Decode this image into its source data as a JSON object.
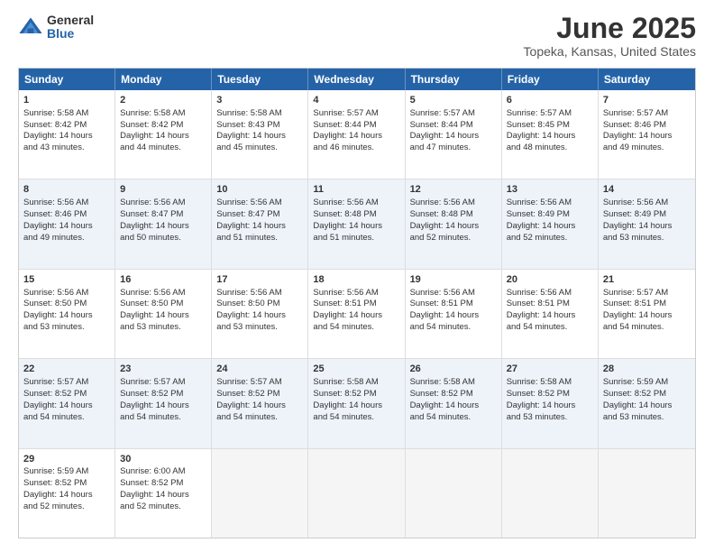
{
  "logo": {
    "general": "General",
    "blue": "Blue"
  },
  "title": "June 2025",
  "location": "Topeka, Kansas, United States",
  "headers": [
    "Sunday",
    "Monday",
    "Tuesday",
    "Wednesday",
    "Thursday",
    "Friday",
    "Saturday"
  ],
  "rows": [
    [
      {
        "day": "1",
        "lines": [
          "Sunrise: 5:58 AM",
          "Sunset: 8:42 PM",
          "Daylight: 14 hours",
          "and 43 minutes."
        ]
      },
      {
        "day": "2",
        "lines": [
          "Sunrise: 5:58 AM",
          "Sunset: 8:42 PM",
          "Daylight: 14 hours",
          "and 44 minutes."
        ]
      },
      {
        "day": "3",
        "lines": [
          "Sunrise: 5:58 AM",
          "Sunset: 8:43 PM",
          "Daylight: 14 hours",
          "and 45 minutes."
        ]
      },
      {
        "day": "4",
        "lines": [
          "Sunrise: 5:57 AM",
          "Sunset: 8:44 PM",
          "Daylight: 14 hours",
          "and 46 minutes."
        ]
      },
      {
        "day": "5",
        "lines": [
          "Sunrise: 5:57 AM",
          "Sunset: 8:44 PM",
          "Daylight: 14 hours",
          "and 47 minutes."
        ]
      },
      {
        "day": "6",
        "lines": [
          "Sunrise: 5:57 AM",
          "Sunset: 8:45 PM",
          "Daylight: 14 hours",
          "and 48 minutes."
        ]
      },
      {
        "day": "7",
        "lines": [
          "Sunrise: 5:57 AM",
          "Sunset: 8:46 PM",
          "Daylight: 14 hours",
          "and 49 minutes."
        ]
      }
    ],
    [
      {
        "day": "8",
        "lines": [
          "Sunrise: 5:56 AM",
          "Sunset: 8:46 PM",
          "Daylight: 14 hours",
          "and 49 minutes."
        ]
      },
      {
        "day": "9",
        "lines": [
          "Sunrise: 5:56 AM",
          "Sunset: 8:47 PM",
          "Daylight: 14 hours",
          "and 50 minutes."
        ]
      },
      {
        "day": "10",
        "lines": [
          "Sunrise: 5:56 AM",
          "Sunset: 8:47 PM",
          "Daylight: 14 hours",
          "and 51 minutes."
        ]
      },
      {
        "day": "11",
        "lines": [
          "Sunrise: 5:56 AM",
          "Sunset: 8:48 PM",
          "Daylight: 14 hours",
          "and 51 minutes."
        ]
      },
      {
        "day": "12",
        "lines": [
          "Sunrise: 5:56 AM",
          "Sunset: 8:48 PM",
          "Daylight: 14 hours",
          "and 52 minutes."
        ]
      },
      {
        "day": "13",
        "lines": [
          "Sunrise: 5:56 AM",
          "Sunset: 8:49 PM",
          "Daylight: 14 hours",
          "and 52 minutes."
        ]
      },
      {
        "day": "14",
        "lines": [
          "Sunrise: 5:56 AM",
          "Sunset: 8:49 PM",
          "Daylight: 14 hours",
          "and 53 minutes."
        ]
      }
    ],
    [
      {
        "day": "15",
        "lines": [
          "Sunrise: 5:56 AM",
          "Sunset: 8:50 PM",
          "Daylight: 14 hours",
          "and 53 minutes."
        ]
      },
      {
        "day": "16",
        "lines": [
          "Sunrise: 5:56 AM",
          "Sunset: 8:50 PM",
          "Daylight: 14 hours",
          "and 53 minutes."
        ]
      },
      {
        "day": "17",
        "lines": [
          "Sunrise: 5:56 AM",
          "Sunset: 8:50 PM",
          "Daylight: 14 hours",
          "and 53 minutes."
        ]
      },
      {
        "day": "18",
        "lines": [
          "Sunrise: 5:56 AM",
          "Sunset: 8:51 PM",
          "Daylight: 14 hours",
          "and 54 minutes."
        ]
      },
      {
        "day": "19",
        "lines": [
          "Sunrise: 5:56 AM",
          "Sunset: 8:51 PM",
          "Daylight: 14 hours",
          "and 54 minutes."
        ]
      },
      {
        "day": "20",
        "lines": [
          "Sunrise: 5:56 AM",
          "Sunset: 8:51 PM",
          "Daylight: 14 hours",
          "and 54 minutes."
        ]
      },
      {
        "day": "21",
        "lines": [
          "Sunrise: 5:57 AM",
          "Sunset: 8:51 PM",
          "Daylight: 14 hours",
          "and 54 minutes."
        ]
      }
    ],
    [
      {
        "day": "22",
        "lines": [
          "Sunrise: 5:57 AM",
          "Sunset: 8:52 PM",
          "Daylight: 14 hours",
          "and 54 minutes."
        ]
      },
      {
        "day": "23",
        "lines": [
          "Sunrise: 5:57 AM",
          "Sunset: 8:52 PM",
          "Daylight: 14 hours",
          "and 54 minutes."
        ]
      },
      {
        "day": "24",
        "lines": [
          "Sunrise: 5:57 AM",
          "Sunset: 8:52 PM",
          "Daylight: 14 hours",
          "and 54 minutes."
        ]
      },
      {
        "day": "25",
        "lines": [
          "Sunrise: 5:58 AM",
          "Sunset: 8:52 PM",
          "Daylight: 14 hours",
          "and 54 minutes."
        ]
      },
      {
        "day": "26",
        "lines": [
          "Sunrise: 5:58 AM",
          "Sunset: 8:52 PM",
          "Daylight: 14 hours",
          "and 54 minutes."
        ]
      },
      {
        "day": "27",
        "lines": [
          "Sunrise: 5:58 AM",
          "Sunset: 8:52 PM",
          "Daylight: 14 hours",
          "and 53 minutes."
        ]
      },
      {
        "day": "28",
        "lines": [
          "Sunrise: 5:59 AM",
          "Sunset: 8:52 PM",
          "Daylight: 14 hours",
          "and 53 minutes."
        ]
      }
    ],
    [
      {
        "day": "29",
        "lines": [
          "Sunrise: 5:59 AM",
          "Sunset: 8:52 PM",
          "Daylight: 14 hours",
          "and 52 minutes."
        ]
      },
      {
        "day": "30",
        "lines": [
          "Sunrise: 6:00 AM",
          "Sunset: 8:52 PM",
          "Daylight: 14 hours",
          "and 52 minutes."
        ]
      },
      {
        "day": "",
        "lines": []
      },
      {
        "day": "",
        "lines": []
      },
      {
        "day": "",
        "lines": []
      },
      {
        "day": "",
        "lines": []
      },
      {
        "day": "",
        "lines": []
      }
    ]
  ]
}
